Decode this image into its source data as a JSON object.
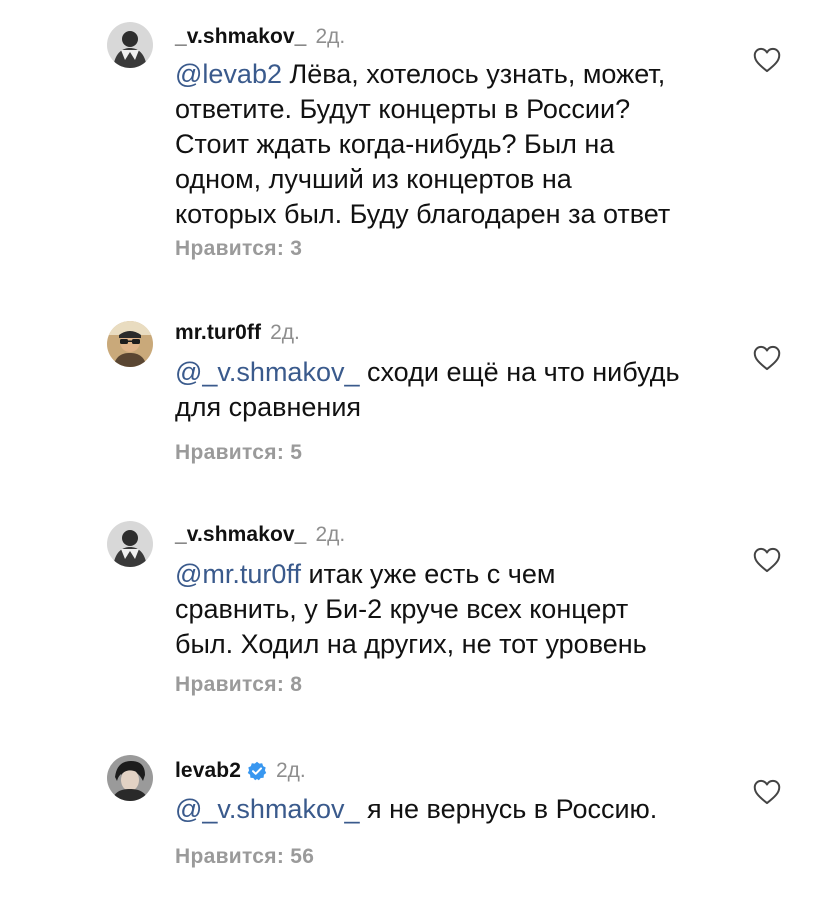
{
  "comments": [
    {
      "username": "_v.shmakov_",
      "time": "2д.",
      "mention": "@levab2",
      "lines": [
        " Лёва, хотелось узнать, может,",
        "ответите. Будут концерты в России?",
        "Стоит ждать когда-нибудь? Был на",
        "одном, лучший из концертов на",
        "которых был. Буду благодарен за ответ"
      ],
      "likes_label": "Нравится: 3",
      "like_icon": "heart-outline-icon",
      "avatar_icon": "user-avatar-photo"
    },
    {
      "username": "mr.tur0ff",
      "time": "2д.",
      "mention": "@_v.shmakov_",
      "lines": [
        " сходи ещё на что нибудь",
        "для сравнения"
      ],
      "likes_label": "Нравится: 5",
      "like_icon": "heart-outline-icon",
      "avatar_icon": "user-avatar-photo"
    },
    {
      "username": "_v.shmakov_",
      "time": "2д.",
      "mention": "@mr.tur0ff",
      "lines": [
        " итак уже есть с чем",
        "сравнить, у Би-2 круче всех концерт",
        "был. Ходил на других, не тот уровень"
      ],
      "likes_label": "Нравится: 8",
      "like_icon": "heart-outline-icon",
      "avatar_icon": "user-avatar-photo"
    },
    {
      "username": "levab2",
      "verified": true,
      "time": "2д.",
      "mention": "@_v.shmakov_",
      "lines": [
        " я не вернусь в Россию."
      ],
      "likes_label": "Нравится: 56",
      "like_icon": "heart-outline-icon",
      "avatar_icon": "user-avatar-photo"
    }
  ],
  "colors": {
    "mention": "#3a5a8c",
    "meta_gray": "#8e8e8e",
    "likes_gray": "#9a9a9a",
    "verified_blue": "#3897f0",
    "text": "#111111"
  }
}
